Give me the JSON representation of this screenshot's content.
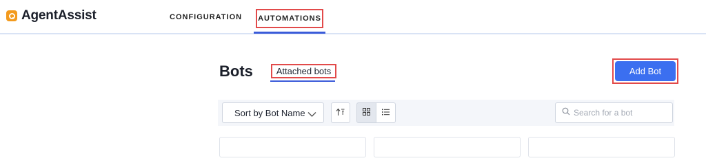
{
  "app": {
    "name": "AgentAssist",
    "brand_color": "#f39a1d",
    "accent_color": "#3b6ff0"
  },
  "nav": {
    "tabs": [
      {
        "label": "CONFIGURATION",
        "active": false
      },
      {
        "label": "AUTOMATIONS",
        "active": true
      }
    ]
  },
  "page": {
    "title": "Bots",
    "subtabs": [
      {
        "label": "Attached bots",
        "active": true
      }
    ],
    "add_button_label": "Add Bot"
  },
  "toolbar": {
    "sort": {
      "selected": "Sort by Bot Name"
    },
    "sort_order_icon": "sort-order-icon",
    "view_modes": [
      {
        "icon": "grid-view-icon",
        "active": true
      },
      {
        "icon": "list-view-icon",
        "active": false
      }
    ],
    "search": {
      "placeholder": "Search for a bot",
      "value": ""
    }
  },
  "cards": [
    {
      "icon": "bot-card"
    },
    {
      "icon": "bot-card"
    },
    {
      "icon": "bot-card"
    }
  ]
}
